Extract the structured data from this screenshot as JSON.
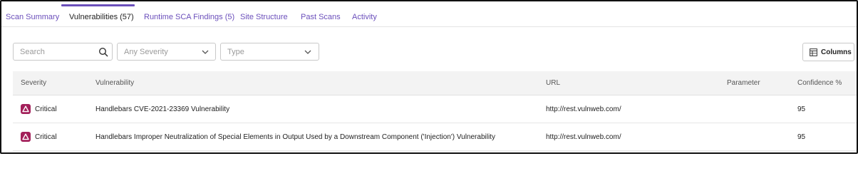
{
  "tabs": [
    {
      "label": "Scan Summary"
    },
    {
      "label": "Vulnerabilities (57)"
    },
    {
      "label": "Runtime SCA Findings (5)"
    },
    {
      "label": "Site Structure"
    },
    {
      "label": "Past Scans"
    },
    {
      "label": "Activity"
    }
  ],
  "active_tab": "Vulnerabilities (57)",
  "filters": {
    "search_placeholder": "Search",
    "severity_placeholder": "Any Severity",
    "type_placeholder": "Type",
    "columns_label": "Columns"
  },
  "table": {
    "headers": {
      "severity": "Severity",
      "vulnerability": "Vulnerability",
      "url": "URL",
      "parameter": "Parameter",
      "confidence": "Confidence %"
    },
    "rows": [
      {
        "severity": "Critical",
        "vulnerability": "Handlebars CVE-2021-23369 Vulnerability",
        "url": "http://rest.vulnweb.com/",
        "parameter": "",
        "confidence": "95"
      },
      {
        "severity": "Critical",
        "vulnerability": "Handlebars Improper Neutralization of Special Elements in Output Used by a Downstream Component ('Injection') Vulnerability",
        "url": "http://rest.vulnweb.com/",
        "parameter": "",
        "confidence": "95"
      }
    ]
  },
  "colors": {
    "accent": "#6b4fbb",
    "critical": "#a3205a"
  },
  "icons": {
    "search": "search-icon",
    "dropdown": "chevron-down-icon",
    "columns": "columns-icon",
    "severity": "critical-triangle-icon"
  }
}
